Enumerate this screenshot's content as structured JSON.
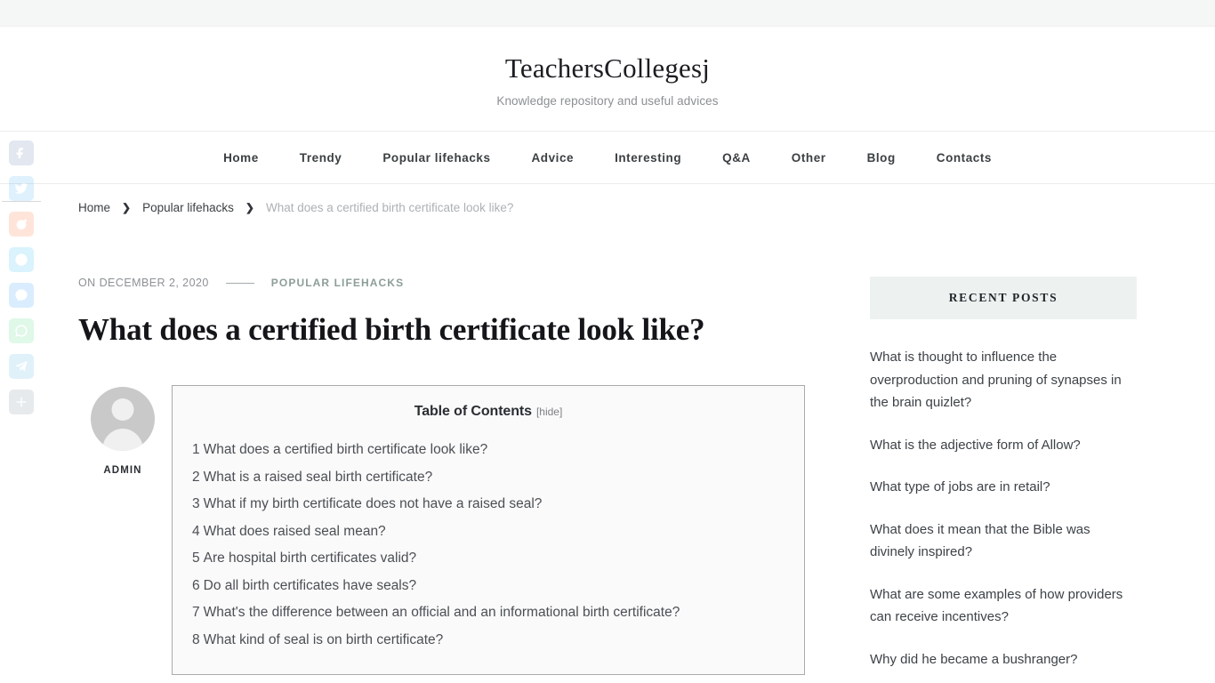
{
  "header": {
    "site_title": "TeachersCollegesj",
    "tagline": "Knowledge repository and useful advices"
  },
  "nav": {
    "items": [
      {
        "label": "Home"
      },
      {
        "label": "Trendy"
      },
      {
        "label": "Popular lifehacks"
      },
      {
        "label": "Advice"
      },
      {
        "label": "Interesting"
      },
      {
        "label": "Q&A"
      },
      {
        "label": "Other"
      },
      {
        "label": "Blog"
      },
      {
        "label": "Contacts"
      }
    ]
  },
  "breadcrumb": {
    "items": [
      {
        "label": "Home"
      },
      {
        "label": "Popular lifehacks"
      },
      {
        "label": "What does a certified birth certificate look like?"
      }
    ],
    "separator": "❯"
  },
  "post": {
    "date": "ON DECEMBER 2, 2020",
    "category": "POPULAR LIFEHACKS",
    "title": "What does a certified birth certificate look like?",
    "author": "ADMIN"
  },
  "toc": {
    "title": "Table of Contents",
    "toggle": "[hide]",
    "items": [
      {
        "num": "1",
        "label": "What does a certified birth certificate look like?"
      },
      {
        "num": "2",
        "label": "What is a raised seal birth certificate?"
      },
      {
        "num": "3",
        "label": "What if my birth certificate does not have a raised seal?"
      },
      {
        "num": "4",
        "label": "What does raised seal mean?"
      },
      {
        "num": "5",
        "label": "Are hospital birth certificates valid?"
      },
      {
        "num": "6",
        "label": "Do all birth certificates have seals?"
      },
      {
        "num": "7",
        "label": "What's the difference between an official and an informational birth certificate?"
      },
      {
        "num": "8",
        "label": "What kind of seal is on birth certificate?"
      }
    ]
  },
  "sidebar": {
    "widget_title": "RECENT POSTS",
    "recent_posts": [
      {
        "label": "What is thought to influence the overproduction and pruning of synapses in the brain quizlet?"
      },
      {
        "label": "What is the adjective form of Allow?"
      },
      {
        "label": "What type of jobs are in retail?"
      },
      {
        "label": "What does it mean that the Bible was divinely inspired?"
      },
      {
        "label": "What are some examples of how providers can receive incentives?"
      },
      {
        "label": "Why did he became a bushranger?"
      }
    ]
  },
  "share_rail": {
    "buttons": [
      {
        "name": "facebook"
      },
      {
        "name": "twitter"
      },
      {
        "name": "reddit"
      },
      {
        "name": "skype"
      },
      {
        "name": "messenger"
      },
      {
        "name": "whatsapp"
      },
      {
        "name": "telegram"
      },
      {
        "name": "share-more"
      }
    ]
  },
  "colors": {
    "category_accent": "#8c9e97",
    "widget_header_bg": "#edf2f1",
    "topbar_bg": "#f5f6f6",
    "toc_border": "#aaaaaa",
    "toc_bg": "#fafafa"
  }
}
